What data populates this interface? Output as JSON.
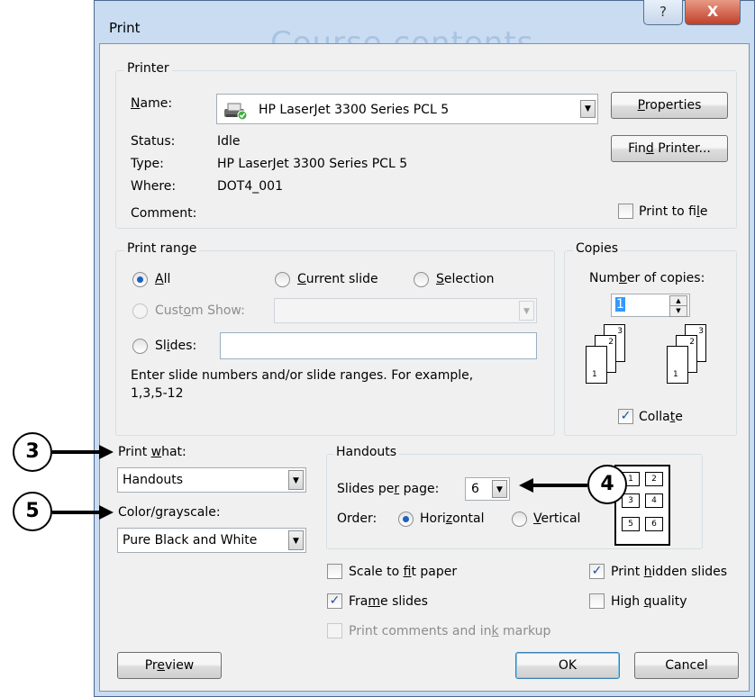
{
  "window": {
    "title": "Print",
    "bg_text": "Course contents",
    "help_label": "?",
    "close_label": "X"
  },
  "printer": {
    "group_label": "Printer",
    "name_label": "Name:",
    "name_value": "HP LaserJet 3300 Series PCL 5",
    "status_label": "Status:",
    "status_value": "Idle",
    "type_label": "Type:",
    "type_value": "HP LaserJet 3300 Series PCL 5",
    "where_label": "Where:",
    "where_value": "DOT4_001",
    "comment_label": "Comment:",
    "properties_button": "Properties",
    "find_printer_button": "Find Printer...",
    "print_to_file_label": "Print to file",
    "print_to_file_checked": false
  },
  "print_range": {
    "group_label": "Print range",
    "all_label": "All",
    "current_slide_label": "Current slide",
    "selection_label": "Selection",
    "custom_show_label": "Custom Show:",
    "slides_label": "Slides:",
    "slides_value": "",
    "hint": "Enter slide numbers and/or slide ranges. For example,",
    "hint_example": "1,3,5-12",
    "selected": "All"
  },
  "copies": {
    "group_label": "Copies",
    "number_label": "Number of copies:",
    "number_value": "1",
    "collate_label": "Collate",
    "collate_checked": true,
    "stack_pages": [
      "1",
      "2",
      "3"
    ]
  },
  "print_what": {
    "label": "Print what:",
    "value": "Handouts",
    "color_label": "Color/grayscale:",
    "color_value": "Pure Black and White"
  },
  "handouts": {
    "group_label": "Handouts",
    "slides_per_page_label": "Slides per page:",
    "slides_per_page_value": "6",
    "order_label": "Order:",
    "horizontal_label": "Horizontal",
    "vertical_label": "Vertical",
    "order_selected": "Horizontal",
    "preview_numbers": [
      "1",
      "2",
      "3",
      "4",
      "5",
      "6"
    ]
  },
  "options": {
    "scale_to_fit_label": "Scale to fit paper",
    "scale_to_fit_checked": false,
    "frame_slides_label": "Frame slides",
    "frame_slides_checked": true,
    "print_comments_label": "Print comments and ink markup",
    "print_comments_checked": false,
    "print_hidden_label": "Print hidden slides",
    "print_hidden_checked": true,
    "high_quality_label": "High quality",
    "high_quality_checked": false
  },
  "footer": {
    "preview_button": "Preview",
    "ok_button": "OK",
    "cancel_button": "Cancel"
  },
  "callouts": [
    "3",
    "5",
    "4"
  ]
}
